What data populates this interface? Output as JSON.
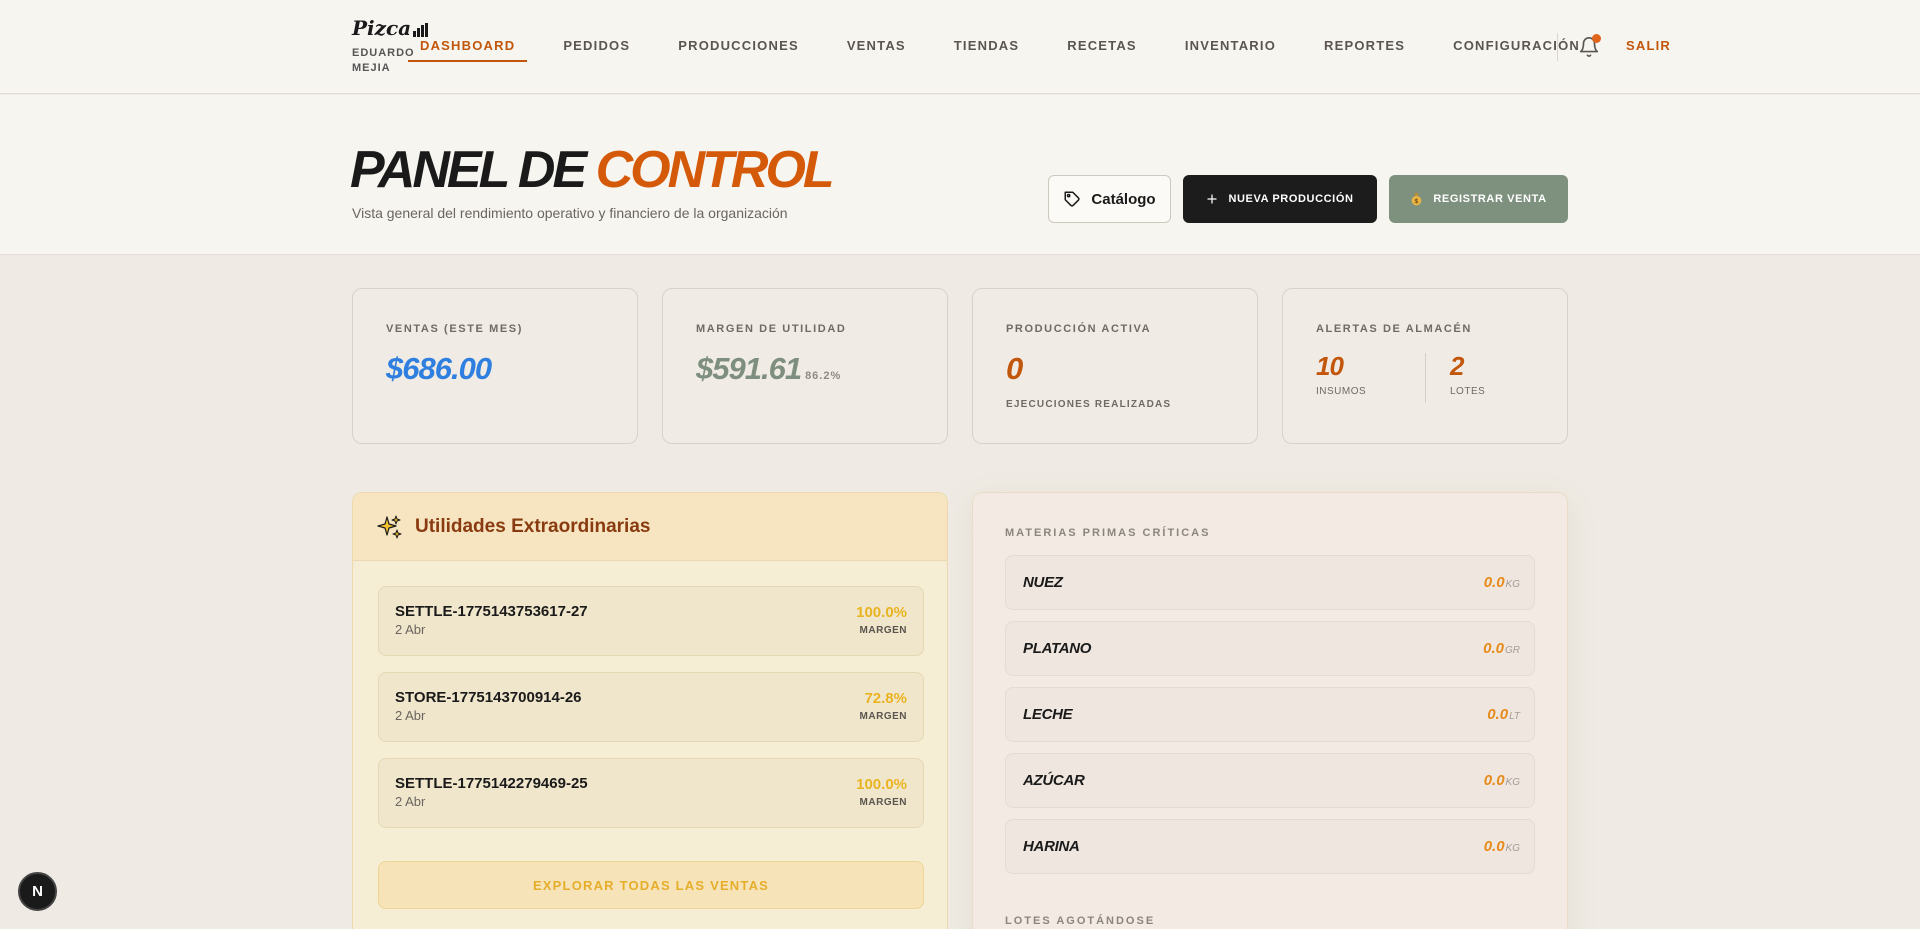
{
  "brand": {
    "name": "Pizca",
    "user_line1": "EDUARDO",
    "user_line2": "MEJIA"
  },
  "nav": {
    "items": [
      "DASHBOARD",
      "PEDIDOS",
      "PRODUCCIONES",
      "VENTAS",
      "TIENDAS",
      "RECETAS",
      "INVENTARIO",
      "REPORTES",
      "CONFIGURACIÓN"
    ],
    "active": "DASHBOARD",
    "logout": "SALIR"
  },
  "header": {
    "title_part1": "PANEL DE",
    "title_part2": "CONTROL",
    "subtitle": "Vista general del rendimiento operativo y financiero de la organización",
    "catalog_btn": "Catálogo",
    "new_btn": "NUEVA PRODUCCIÓN",
    "sale_btn": "REGISTRAR VENTA"
  },
  "kpis": {
    "sales": {
      "label": "VENTAS (ESTE MES)",
      "value": "$686.00",
      "color": "#2f7fe0"
    },
    "margin": {
      "label": "MARGEN DE UTILIDAD",
      "value": "$591.61",
      "pct": "86.2%",
      "color": "#7e8f7f"
    },
    "production": {
      "label": "PRODUCCIÓN ACTIVA",
      "value": "0",
      "note": "EJECUCIONES REALIZADAS",
      "color": "#c2560b"
    },
    "alerts": {
      "label": "ALERTAS DE ALMACÉN",
      "insumos_value": "10",
      "insumos_label": "INSUMOS",
      "lotes_value": "2",
      "lotes_label": "LOTES"
    }
  },
  "utilities": {
    "title": "Utilidades Extraordinarias",
    "rows": [
      {
        "id": "SETTLE-1775143753617-27",
        "date": "2 Abr",
        "pct": "100.0%",
        "margin_label": "MARGEN"
      },
      {
        "id": "STORE-1775143700914-26",
        "date": "2 Abr",
        "pct": "72.8%",
        "margin_label": "MARGEN"
      },
      {
        "id": "SETTLE-1775142279469-25",
        "date": "2 Abr",
        "pct": "100.0%",
        "margin_label": "MARGEN"
      }
    ],
    "explore_btn": "EXPLORAR TODAS LAS VENTAS"
  },
  "materials": {
    "section_label": "MATERIAS PRIMAS CRÍTICAS",
    "rows": [
      {
        "name": "NUEZ",
        "qty": "0.0",
        "unit": "KG"
      },
      {
        "name": "PLATANO",
        "qty": "0.0",
        "unit": "GR"
      },
      {
        "name": "LECHE",
        "qty": "0.0",
        "unit": "LT"
      },
      {
        "name": "AZÚCAR",
        "qty": "0.0",
        "unit": "KG"
      },
      {
        "name": "HARINA",
        "qty": "0.0",
        "unit": "KG"
      }
    ],
    "lots_label": "LOTES AGOTÁNDOSE"
  },
  "floating_badge": "N"
}
